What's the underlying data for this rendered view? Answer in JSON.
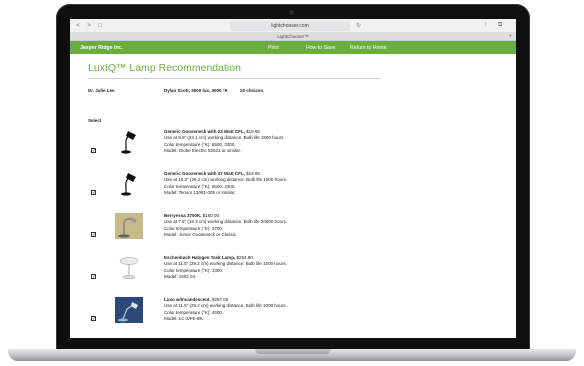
{
  "browser": {
    "url": "lightchooser.com",
    "tab_title": "LightChooser™",
    "nav": {
      "back": "<",
      "forward": ">",
      "sidebar": "□",
      "reload": "↻",
      "share": "↑",
      "tabs": "⧉",
      "new_tab": "+"
    }
  },
  "header": {
    "brand": "Jasper Ridge Inc.",
    "links": [
      "Print",
      "How to Save",
      "Return to Home"
    ],
    "bg_color": "#6aaf3e"
  },
  "page": {
    "title": "LuxIQ™ Lamp Recommendation",
    "doctor": "Dr. Julie Lee",
    "patient_summary": "Dylan Scott, 3000 lux, 3000 °K",
    "choices": "20 choices",
    "select_label": "Select"
  },
  "products": [
    {
      "name": "Generic Gooseneck with 23 Watt CFL,",
      "price": " $19.95",
      "line1": "Use at 9.5\" (24.1 cm) working distance. Bulb life 1500 hours.",
      "line2": "Color temperature (°K): 6500, 3300.",
      "line3": "Model: Globe Electric 52021 or similar.",
      "checked": "✓",
      "thumb": "black-gooseneck-lamp"
    },
    {
      "name": "Generic Gooseneck with 27 Watt CFL,",
      "price": " $19.95",
      "line1": "Use at 10.3\" (26.2 cm) working distance. Bulb life 1500 hours.",
      "line2": "Color temperature (°K): 6500, 3300.",
      "line3": "Model: Tensor 13061-005 or similar.",
      "checked": "✓",
      "thumb": "black-gooseneck-lamp"
    },
    {
      "name": "Berryessa 3700K,",
      "price": " $160.00",
      "line1": "Use at 7.6\" (19.3 cm) working distance. Bulb life 20000 hours.",
      "line2": "Color temperature (°K): 3700.",
      "line3": "Model: Junior Gooseneck or Classic.",
      "checked": "✓",
      "thumb": "silver-desk-lamp-photo"
    },
    {
      "name": "Eschenbach Halogen Task Lamp,",
      "price": " $284.80",
      "line1": "Use at 11.5\" (29.2 cm) working distance. Bulb life 1500 hours.",
      "line2": "Color temperature (°K): 3300.",
      "line3": "Model: 1602 04.",
      "checked": "✓",
      "thumb": "white-halogen-lamp"
    },
    {
      "name": "Luxo w/Incandescent,",
      "price": " $297.00",
      "line1": "Use at 11.5\" (29.2 cm) working distance. Bulb life 1000 hours.",
      "line2": "Color temperature (°K): 4500.",
      "line3": "Model: LC-2/FE-BK.",
      "checked": "✓",
      "thumb": "blue-luxo-lamp-photo"
    }
  ]
}
